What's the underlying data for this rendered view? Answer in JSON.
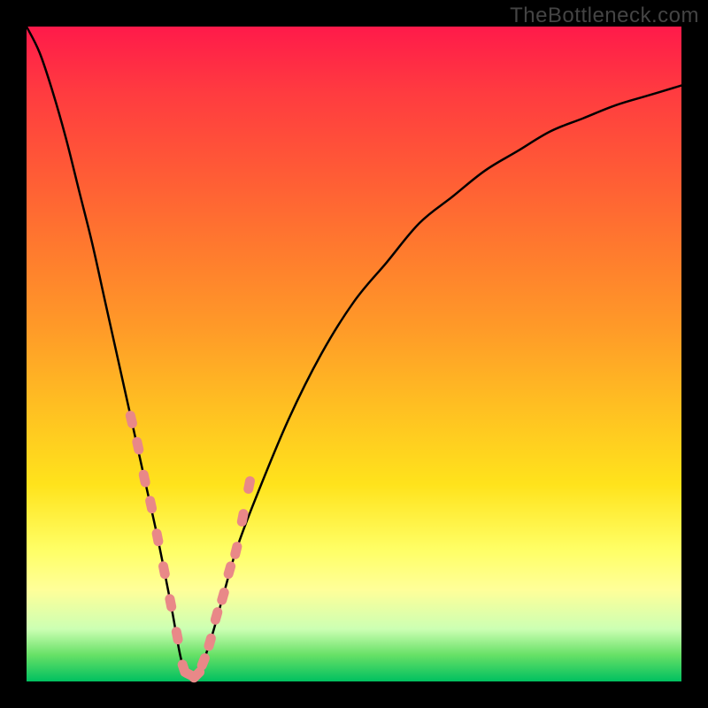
{
  "watermark": "TheBottleneck.com",
  "colors": {
    "frame": "#000000",
    "curve": "#000000",
    "marker_fill": "#e98888",
    "marker_stroke": "#d76a6a"
  },
  "chart_data": {
    "type": "line",
    "title": "",
    "xlabel": "",
    "ylabel": "",
    "xlim": [
      0,
      100
    ],
    "ylim": [
      0,
      100
    ],
    "note": "V-shaped bottleneck curve; y ≈ 0 (green) is ideal, y ≈ 100 (red) is worst. Minimum near x ≈ 24.",
    "series": [
      {
        "name": "bottleneck-curve",
        "x": [
          0,
          2,
          4,
          6,
          8,
          10,
          12,
          14,
          16,
          18,
          20,
          22,
          24,
          26,
          28,
          30,
          32,
          35,
          40,
          45,
          50,
          55,
          60,
          65,
          70,
          75,
          80,
          85,
          90,
          95,
          100
        ],
        "y": [
          100,
          96,
          90,
          83,
          75,
          67,
          58,
          49,
          40,
          31,
          22,
          12,
          2,
          1,
          6,
          13,
          20,
          28,
          40,
          50,
          58,
          64,
          70,
          74,
          78,
          81,
          84,
          86,
          88,
          89.5,
          91
        ]
      }
    ],
    "markers": {
      "name": "highlighted-points",
      "x": [
        16,
        17,
        18,
        19,
        20,
        21,
        22,
        23,
        24,
        25,
        26,
        27,
        28,
        29,
        30,
        31,
        32,
        33,
        34
      ],
      "y": [
        40,
        36,
        31,
        27,
        22,
        17,
        12,
        7,
        2,
        1,
        1,
        3,
        6,
        10,
        13,
        17,
        20,
        25,
        30
      ]
    }
  }
}
